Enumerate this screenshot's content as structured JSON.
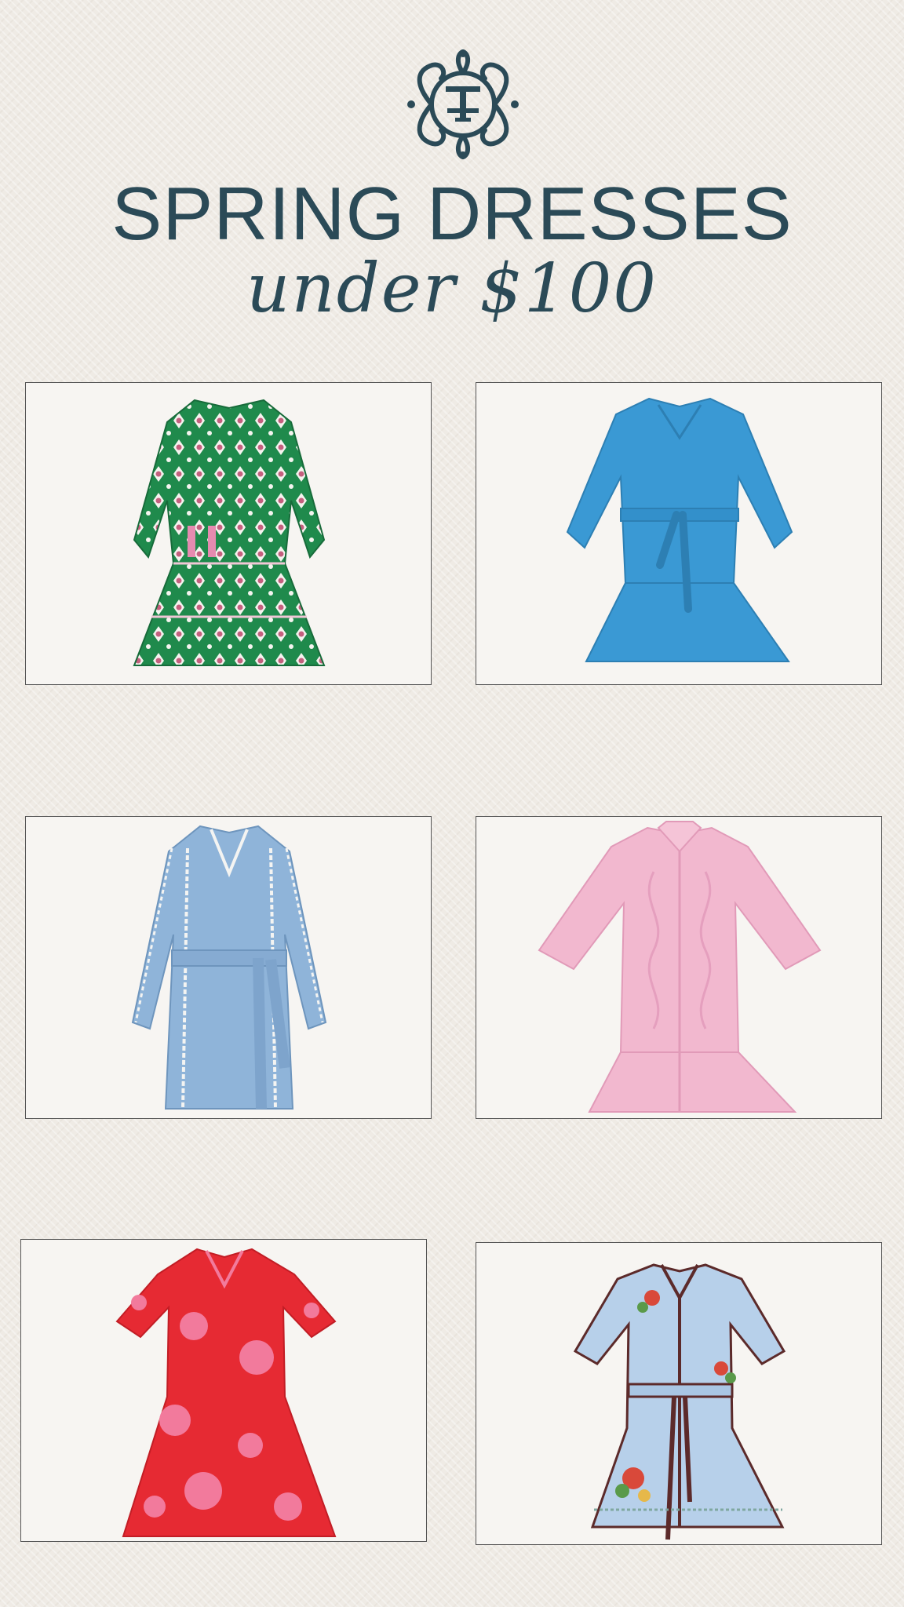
{
  "header": {
    "title": "SPRING DRESSES",
    "subtitle": "under $100"
  },
  "brand": {
    "logo_icon": "tt-monogram-crest",
    "logo_color": "#2b4a57"
  },
  "colors": {
    "background": "#efebe5",
    "text": "#2b4a57",
    "card_background": "#f7f5f2"
  },
  "products": [
    {
      "icon": "green-floral-tiered-dress",
      "color": "#1f8a4c"
    },
    {
      "icon": "blue-belted-tiered-dress",
      "color": "#3a99d4"
    },
    {
      "icon": "chambray-belted-dress",
      "color": "#8fb4d9"
    },
    {
      "icon": "pink-embroidered-shirt-dress",
      "color": "#f2b8cf"
    },
    {
      "icon": "red-floral-dress",
      "color": "#e62a33"
    },
    {
      "icon": "light-blue-embroidered-shirt-dress",
      "color": "#b7d0ea"
    }
  ]
}
